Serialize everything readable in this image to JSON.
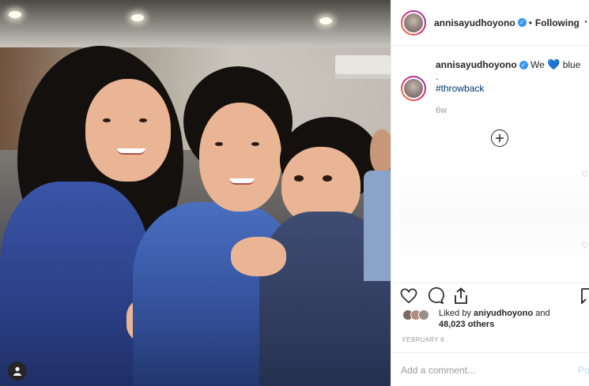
{
  "header": {
    "username": "annisayudhoyono",
    "separator": "•",
    "follow_status": "Following",
    "more_icon": "ellipsis-icon"
  },
  "caption": {
    "username": "annisayudhoyono",
    "text_before": "We",
    "emoji": "💙",
    "text_after": "blue",
    "line2": ".",
    "hashtag": "#throwback",
    "time_ago": "6w"
  },
  "comments": {
    "load_more_label": "⊕"
  },
  "actions": {
    "like_icon": "heart-icon",
    "comment_icon": "comment-icon",
    "share_icon": "share-icon",
    "save_icon": "bookmark-icon"
  },
  "likes": {
    "prefix": "Liked by",
    "user": "aniyudhoyono",
    "joiner": "and",
    "count": "48,023 others"
  },
  "date": "FEBRUARY 8",
  "comment_box": {
    "placeholder": "Add a comment...",
    "post_label": "Po"
  },
  "colors": {
    "accent_blue": "#3897f0",
    "hashtag": "#003569",
    "muted": "#999999"
  }
}
